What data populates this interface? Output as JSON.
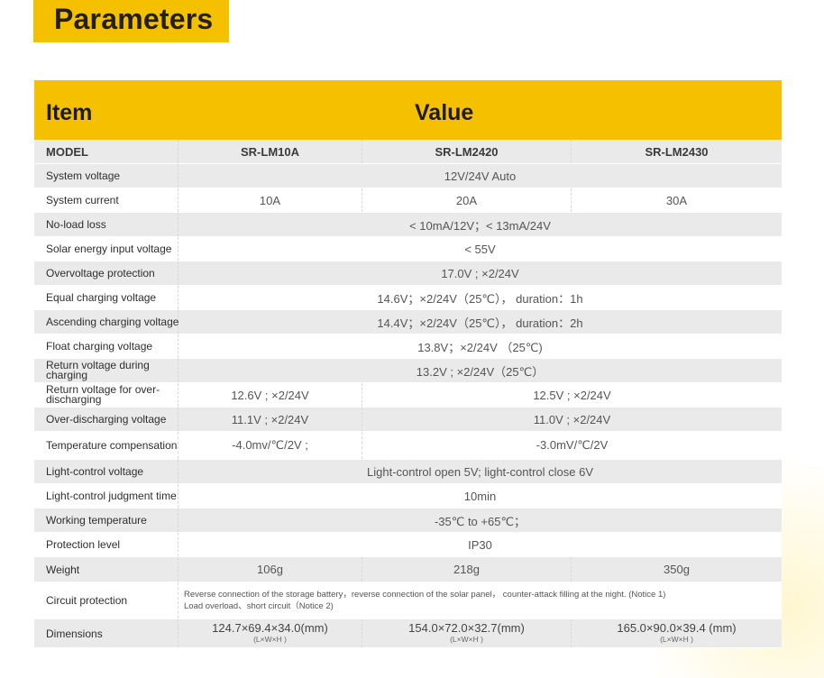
{
  "title": "Parameters",
  "header": {
    "item": "Item",
    "value": "Value"
  },
  "model": {
    "label": "MODEL",
    "m1": "SR-LM10A",
    "m2": "SR-LM2420",
    "m3": "SR-LM2430"
  },
  "rows": {
    "system_voltage": {
      "label": "System voltage",
      "value": "12V/24V Auto"
    },
    "system_current": {
      "label": "System current",
      "v1": "10A",
      "v2": "20A",
      "v3": "30A"
    },
    "no_load_loss": {
      "label": "No-load loss",
      "value": "< 10mA/12V；< 13mA/24V"
    },
    "solar_input": {
      "label": "Solar energy input voltage",
      "value": "< 55V"
    },
    "overvoltage": {
      "label": "Overvoltage protection",
      "value": "17.0V ; ×2/24V"
    },
    "equal_charging": {
      "label": "Equal charging voltage",
      "value": "14.6V；×2/24V（25℃）， duration：1h"
    },
    "ascending_charging": {
      "label": "Ascending charging voltage",
      "value": "14.4V；×2/24V（25℃）， duration：2h"
    },
    "float_charging": {
      "label": "Float charging voltage",
      "value": "13.8V；×2/24V （25℃)"
    },
    "return_charging": {
      "label": "Return voltage during charging",
      "value": "13.2V ; ×2/24V（25℃）"
    },
    "return_overdischarging": {
      "label": "Return voltage for over-discharging",
      "v1": "12.6V ; ×2/24V",
      "v23": "12.5V ; ×2/24V"
    },
    "over_discharging": {
      "label": "Over-discharging voltage",
      "v1": "11.1V ; ×2/24V",
      "v23": "11.0V ; ×2/24V"
    },
    "temp_comp": {
      "label": "Temperature compensation",
      "v1": "-4.0mv/℃/2V ;",
      "v23": "-3.0mV/℃/2V"
    },
    "light_control": {
      "label": "Light-control voltage",
      "value": "Light-control open 5V; light-control close 6V"
    },
    "light_judgment": {
      "label": "Light-control judgment time",
      "value": "10min"
    },
    "working_temp": {
      "label": "Working temperature",
      "value": "-35℃ to +65℃；"
    },
    "protection_level": {
      "label": "Protection level",
      "value": "IP30"
    },
    "weight": {
      "label": "Weight",
      "v1": "106g",
      "v2": "218g",
      "v3": "350g"
    },
    "circuit_protection": {
      "label": "Circuit protection",
      "line1": "Reverse connection of the storage battery，reverse connection of the solar panel， counter-attack filling at the night. (Notice 1)",
      "line2": "Load overload、short circuit（Notice 2)"
    },
    "dimensions": {
      "label": "Dimensions",
      "v1": "124.7×69.4×34.0(mm)",
      "v2": "154.0×72.0×32.7(mm)",
      "v3": "165.0×90.0×39.4 (mm)",
      "unit": "(L×W×H )"
    }
  },
  "colors": {
    "accent": "#f5c000",
    "row_alt": "#eaeaea"
  }
}
